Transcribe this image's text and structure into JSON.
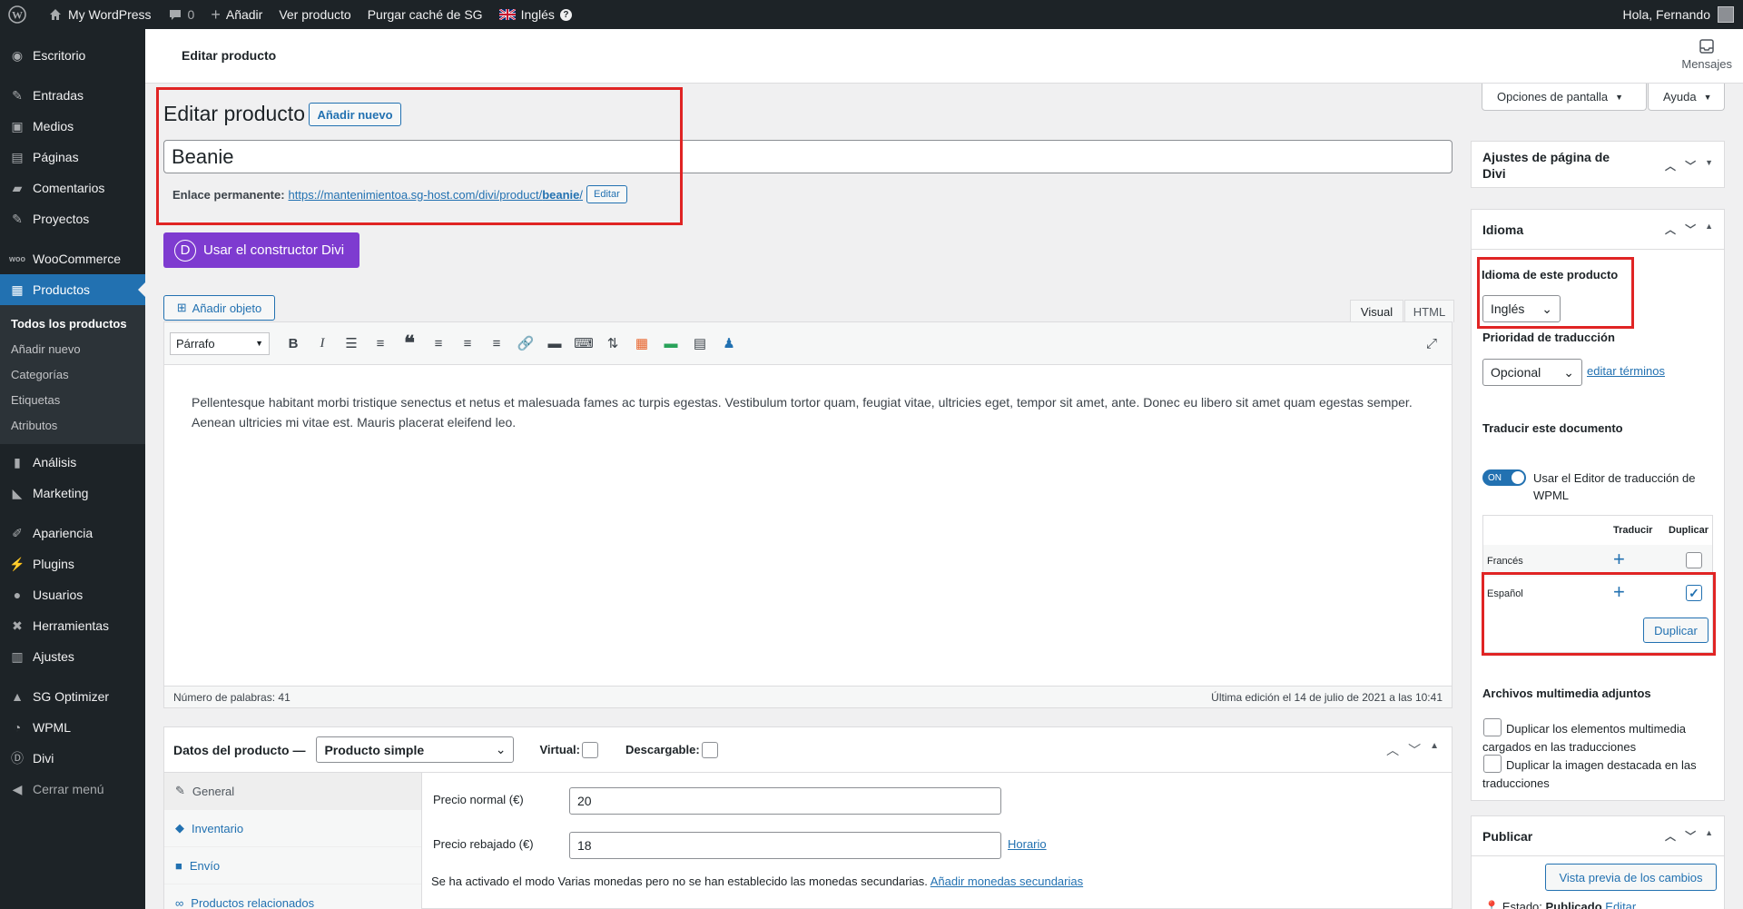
{
  "adminbar": {
    "site_name": "My WordPress",
    "comments_count": "0",
    "add_label": "Añadir",
    "view_product": "Ver producto",
    "purge_cache": "Purgar caché de SG",
    "language": "Inglés",
    "greeting": "Hola, Fernando"
  },
  "sidebar": {
    "items": [
      {
        "label": "Escritorio"
      },
      {
        "label": "Entradas"
      },
      {
        "label": "Medios"
      },
      {
        "label": "Páginas"
      },
      {
        "label": "Comentarios"
      },
      {
        "label": "Proyectos"
      },
      {
        "label": "WooCommerce"
      },
      {
        "label": "Productos"
      },
      {
        "label": "Análisis"
      },
      {
        "label": "Marketing"
      },
      {
        "label": "Apariencia"
      },
      {
        "label": "Plugins"
      },
      {
        "label": "Usuarios"
      },
      {
        "label": "Herramientas"
      },
      {
        "label": "Ajustes"
      },
      {
        "label": "SG Optimizer"
      },
      {
        "label": "WPML"
      },
      {
        "label": "Divi"
      },
      {
        "label": "Cerrar menú"
      }
    ],
    "submenu": [
      "Todos los productos",
      "Añadir nuevo",
      "Categorías",
      "Etiquetas",
      "Atributos"
    ]
  },
  "header": {
    "title": "Editar producto",
    "messages": "Mensajes",
    "screen_options": "Opciones de pantalla",
    "help": "Ayuda"
  },
  "main": {
    "heading": "Editar producto",
    "add_new": "Añadir nuevo",
    "title_value": "Beanie",
    "permalink_label": "Enlace permanente:",
    "permalink_base": "https://mantenimientoa.sg-host.com/divi/product/",
    "permalink_slug": "beanie",
    "permalink_tail": "/",
    "edit": "Editar",
    "divi_button": "Usar el constructor Divi",
    "add_object": "Añadir objeto",
    "tab_visual": "Visual",
    "tab_html": "HTML",
    "format": "Párrafo",
    "content": "Pellentesque habitant morbi tristique senectus et netus et malesuada fames ac turpis egestas. Vestibulum tortor quam, feugiat vitae, ultricies eget, tempor sit amet, ante. Donec eu libero sit amet quam egestas semper. Aenean ultricies mi vitae est. Mauris placerat eleifend leo.",
    "word_count": "Número de palabras: 41",
    "last_edit": "Última edición el 14 de julio de 2021 a las 10:41"
  },
  "product_data": {
    "title": "Datos del producto —",
    "type": "Producto simple",
    "virtual": "Virtual:",
    "downloadable": "Descargable:",
    "nav": [
      "General",
      "Inventario",
      "Envío",
      "Productos relacionados"
    ],
    "regular_price_label": "Precio normal (€)",
    "regular_price": "20",
    "sale_price_label": "Precio rebajado (€)",
    "sale_price": "18",
    "schedule": "Horario",
    "notice": "Se ha activado el modo Varias monedas pero no se han establecido las monedas secundarias.",
    "notice_link": "Añadir monedas secundarias"
  },
  "right": {
    "divi_box": "Ajustes de página de Divi",
    "lang_box": "Idioma",
    "lang_label": "Idioma de este producto",
    "lang_value": "Inglés",
    "priority_label": "Prioridad de traducción",
    "priority_value": "Opcional",
    "edit_terms": "editar términos",
    "translate_doc": "Traducir este documento",
    "toggle": "ON",
    "use_editor": "Usar el Editor de traducción de WPML",
    "col_translate": "Traducir",
    "col_duplicate": "Duplicar",
    "lang_rows": [
      "Francés",
      "Español"
    ],
    "duplicate_btn": "Duplicar",
    "media_title": "Archivos multimedia adjuntos",
    "media_opt1": "Duplicar los elementos multimedia cargados en las traducciones",
    "media_opt2": "Duplicar la imagen destacada en las traducciones",
    "publish_box": "Publicar",
    "preview_btn": "Vista previa de los cambios",
    "status_label": "Estado:",
    "status_value": "Publicado",
    "status_edit": "Editar"
  }
}
